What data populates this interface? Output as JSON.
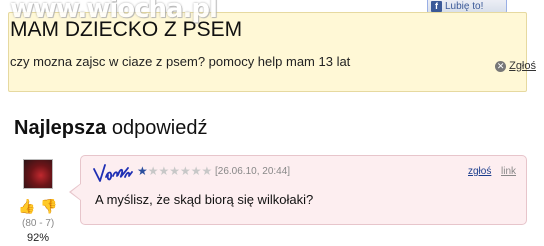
{
  "watermark": "www.wiocha.pl",
  "like_button": {
    "label": "Lubię to!"
  },
  "question": {
    "title": "MAM DZIECKO Z PSEM",
    "body": "czy mozna zajsc w ciaze z psem? pomocy help mam 13 lat",
    "report_label": "Zgłoś"
  },
  "best_answer": {
    "heading_bold": "Najlepsza",
    "heading_rest": " odpowiedź",
    "vote_up_icon": "thumbs-up-icon",
    "vote_down_icon": "thumbs-down-icon",
    "vote_counts": "(80 - 7)",
    "vote_percent": "92%",
    "rating": {
      "filled": 1,
      "total": 7
    },
    "timestamp": "[26.06.10, 20:44]",
    "report_label": "zgłoś",
    "link_label": "link",
    "text": "A myślisz, że skąd biorą się wilkołaki?",
    "colors": {
      "bubble_bg": "#fdeef0",
      "bubble_border": "#e7c5cb",
      "star_on": "#2c4f9e"
    }
  },
  "colors": {
    "question_bg": "#fff8d6",
    "question_border": "#e6d9a0",
    "fb_blue": "#3b5998"
  }
}
